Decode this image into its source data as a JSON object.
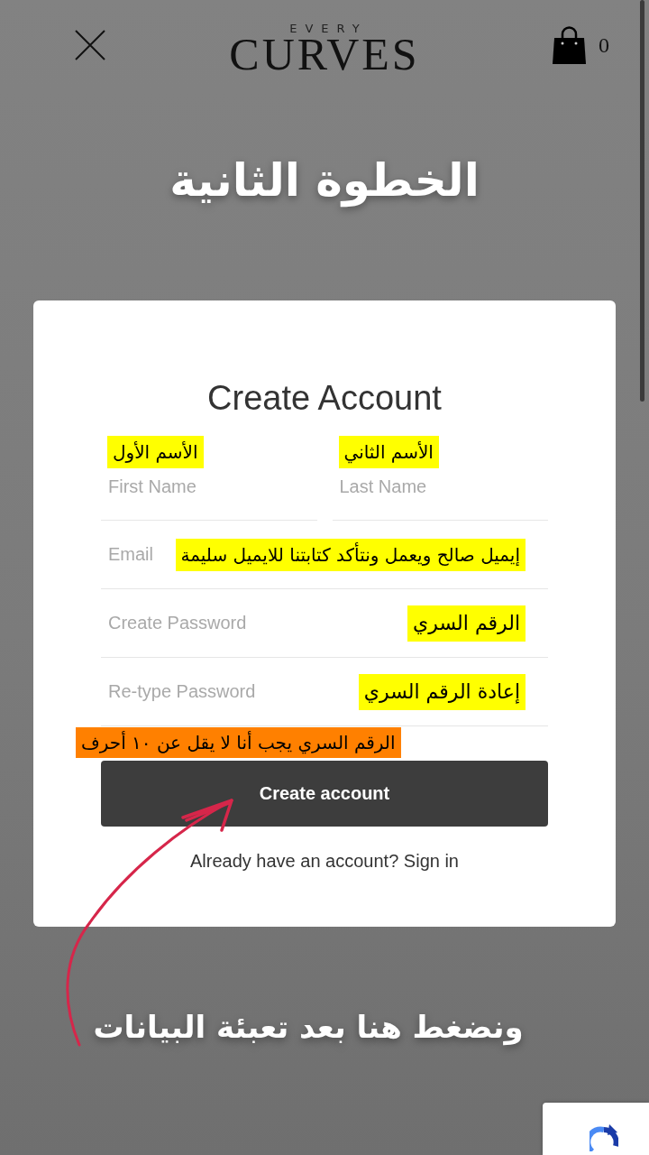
{
  "header": {
    "brand_top": "EVERY",
    "brand": "CURVES",
    "cart_count": "0"
  },
  "step_title": "الخطوة الثانية",
  "form": {
    "title": "Create Account",
    "first_name": {
      "placeholder": "First Name",
      "annotation": "الأسم الأول"
    },
    "last_name": {
      "placeholder": "Last Name",
      "annotation": "الأسم الثاني"
    },
    "fields": [
      {
        "placeholder": "Email",
        "annotation": "إيميل صالح ويعمل ونتأكد كتابتنا للايميل سليمة"
      },
      {
        "placeholder": "Create Password",
        "annotation": "الرقم السري"
      },
      {
        "placeholder": "Re-type Password",
        "annotation": "إعادة الرقم السري"
      }
    ],
    "password_note": "الرقم السري يجب أنا لا يقل عن ١٠ أحرف",
    "submit_button": "Create account",
    "sign_in_prompt": "Already have an account?",
    "sign_in_link": "Sign in"
  },
  "hint": "ونضغط هنا بعد تعبئة البيانات"
}
